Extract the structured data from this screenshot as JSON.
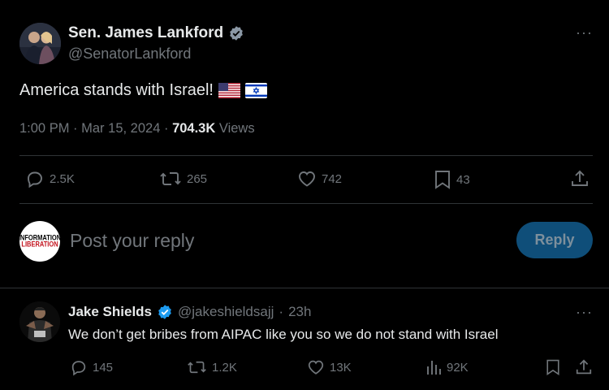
{
  "main_tweet": {
    "author_name": "Sen. James Lankford",
    "author_handle": "@SenatorLankford",
    "more_label": "···",
    "text": "America stands with Israel!",
    "flags": [
      "us-flag",
      "israel-flag"
    ],
    "time": "1:00 PM",
    "date": "Mar 15, 2024",
    "views_count": "704.3K",
    "views_label": "Views",
    "actions": {
      "replies": "2.5K",
      "reposts": "265",
      "likes": "742",
      "bookmarks": "43"
    }
  },
  "composer": {
    "avatar_line1": "INFORMATION",
    "avatar_line2": "LIBERATION",
    "placeholder": "Post your reply",
    "reply_label": "Reply"
  },
  "reply_tweet": {
    "author_name": "Jake Shields",
    "author_handle": "@jakeshieldsajj",
    "separator": "·",
    "time_ago": "23h",
    "more_label": "···",
    "text": "We don’t get bribes from AIPAC like you so we do not stand with Israel",
    "actions": {
      "replies": "145",
      "reposts": "1.2K",
      "likes": "13K",
      "views": "92K"
    }
  },
  "colors": {
    "background": "#000000",
    "text": "#e7e9ea",
    "muted": "#71767b",
    "verified_blue": "#1d9bf0",
    "reply_button": "#0f4e79"
  }
}
